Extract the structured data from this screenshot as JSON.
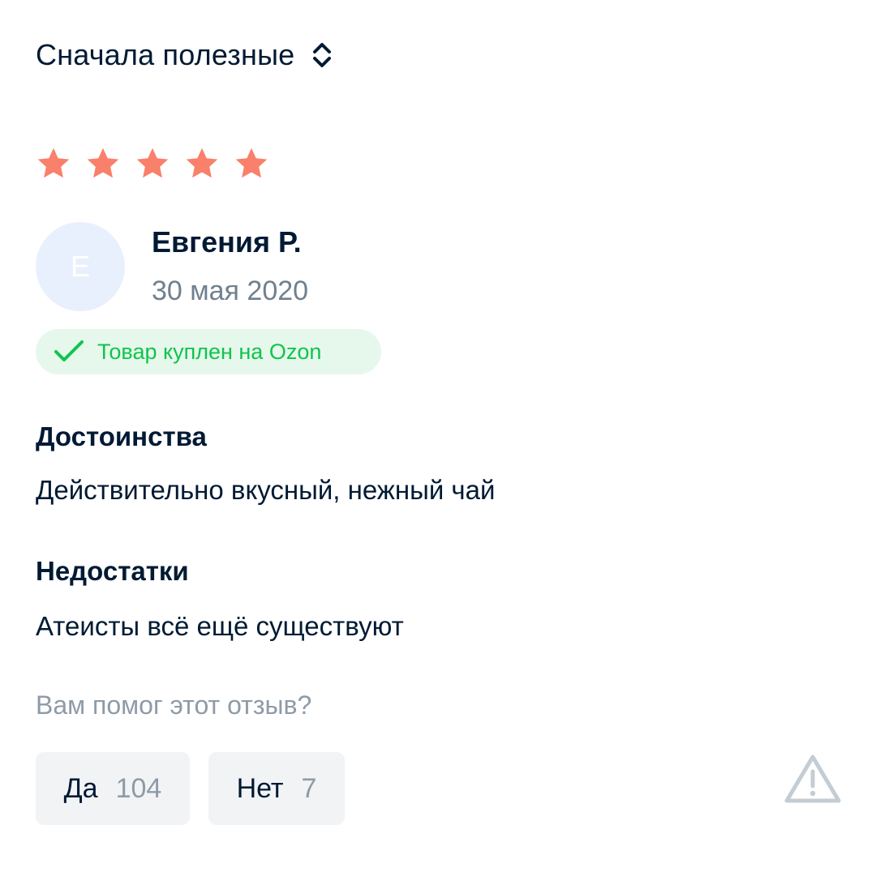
{
  "sort": {
    "label": "Сначала полезные",
    "icon": "sort-updown-icon"
  },
  "review": {
    "rating": 5,
    "rating_max": 5,
    "star_color": "#f9806a",
    "author": {
      "initial": "Е",
      "name": "Евгения Р.",
      "avatar_color": "#e9f0fd"
    },
    "date": "30 мая 2020",
    "verified": {
      "text": "Товар куплен на Ozon",
      "icon": "check-icon",
      "color": "#10c44c"
    },
    "pros": {
      "title": "Достоинства",
      "text": "Действительно вкусный, нежный чай"
    },
    "cons": {
      "title": "Недостатки",
      "text": "Атеисты всё ещё существуют"
    },
    "helpful": {
      "question": "Вам помог этот отзыв?",
      "yes_label": "Да",
      "yes_count": "104",
      "no_label": "Нет",
      "no_count": "7"
    },
    "report_icon": "warning-icon"
  }
}
